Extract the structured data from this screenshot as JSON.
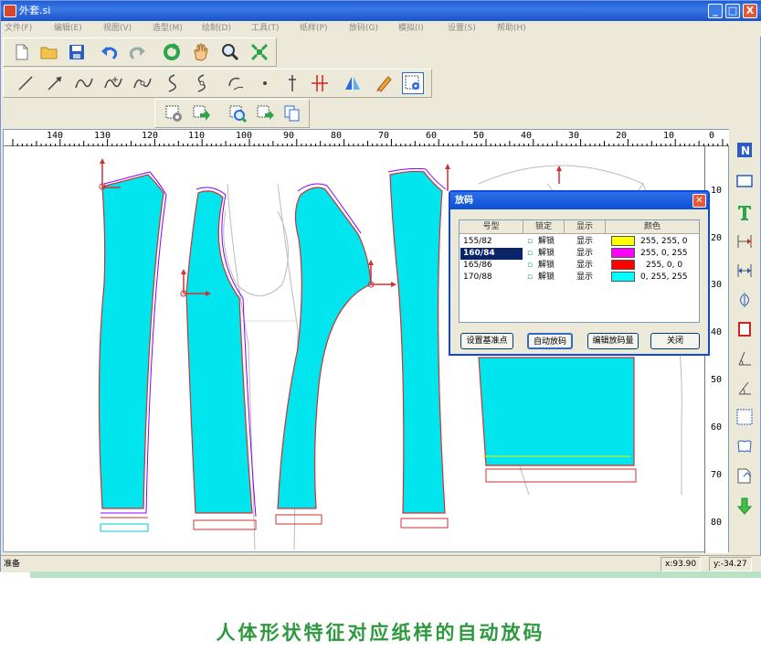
{
  "window": {
    "title": "外套.si",
    "minimize": "_",
    "maximize": "□",
    "close": "X"
  },
  "menu": [
    "文件(F)",
    "编辑(E)",
    "视图(V)",
    "造型(M)",
    "绘制(D)",
    "工具(T)",
    "纸样(P)",
    "放码(G)",
    "模拟(I)",
    "设置(S)",
    "帮助(H)"
  ],
  "toolbar1": {
    "icons": [
      "new-file-icon",
      "open-folder-icon",
      "save-icon",
      "undo-icon",
      "redo-icon",
      "refresh-icon",
      "hand-pan-icon",
      "zoom-icon",
      "fit-view-icon"
    ]
  },
  "toolbar2": {
    "icons": [
      "line-icon",
      "arrow-line-icon",
      "curve-icon",
      "curve-point-icon",
      "curve-edit-icon",
      "spline-icon",
      "spline-edit-icon",
      "arc-icon",
      "point-icon",
      "perpendicular-icon",
      "parallel-icon",
      "mirror-icon",
      "ruler-pencil-icon",
      "view-piece-icon"
    ]
  },
  "toolbar3": {
    "icons": [
      "piece-settings-icon",
      "piece-export-icon",
      "piece-zoom-icon",
      "piece-move-icon",
      "piece-copy-icon"
    ]
  },
  "ruler": {
    "h_labels": [
      "140",
      "130",
      "120",
      "110",
      "100",
      "90",
      "80",
      "70",
      "60",
      "50",
      "40",
      "30",
      "20",
      "10",
      "0"
    ],
    "v_labels": [
      "10",
      "20",
      "30",
      "40",
      "50",
      "60",
      "70",
      "80"
    ]
  },
  "right_tools": [
    "n-icon",
    "rectangle-icon",
    "text-t-icon",
    "dimension-icon",
    "dimension-arrow-icon",
    "symmetry-icon",
    "frame-icon",
    "angle-icon",
    "angle-measure-icon",
    "grid-icon",
    "book-icon",
    "copy-page-icon",
    "download-arrow-icon"
  ],
  "dialog": {
    "title": "放码",
    "columns": [
      "号型",
      "锁定",
      "显示",
      "颜色"
    ],
    "rows": [
      {
        "size": "155/82",
        "lock": "解锁",
        "show": "显示",
        "color": "#ffff00",
        "color_text": "255, 255, 0",
        "selected": false
      },
      {
        "size": "160/84",
        "lock": "解锁",
        "show": "显示",
        "color": "#ff00ff",
        "color_text": "255, 0, 255",
        "selected": true
      },
      {
        "size": "165/86",
        "lock": "解锁",
        "show": "显示",
        "color": "#ff0000",
        "color_text": "255, 0, 0",
        "selected": false
      },
      {
        "size": "170/88",
        "lock": "解锁",
        "show": "显示",
        "color": "#00ffff",
        "color_text": "0, 255, 255",
        "selected": false
      }
    ],
    "buttons": {
      "set_base": "设置基准点",
      "auto_grade": "自动放码",
      "edit_grade": "编辑放码量",
      "close": "关闭"
    }
  },
  "status": {
    "text": "准备",
    "x": "x:93.90",
    "y": "y:-34.27"
  },
  "caption": "人体形状特征对应纸样的自动放码",
  "colors": {
    "piece_fill": "#00e5ee",
    "accent": "#2c9a3c",
    "title_blue": "#1f5fd6"
  }
}
